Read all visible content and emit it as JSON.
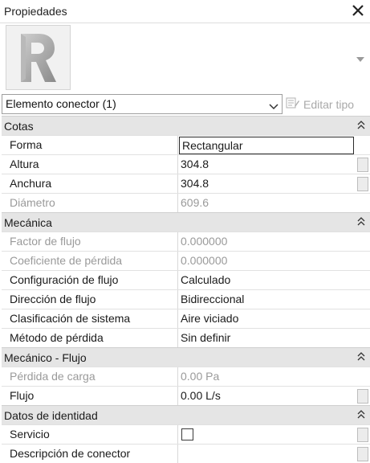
{
  "panel": {
    "title": "Propiedades"
  },
  "type_selector": {
    "value": "Elemento conector (1)",
    "edit_type_label": "Editar tipo"
  },
  "groups": [
    {
      "label": "Cotas",
      "rows": [
        {
          "name": "Forma",
          "value": "Rectangular"
        },
        {
          "name": "Altura",
          "value": "304.8"
        },
        {
          "name": "Anchura",
          "value": "304.8"
        },
        {
          "name": "Diámetro",
          "value": "609.6"
        }
      ]
    },
    {
      "label": "Mecánica",
      "rows": [
        {
          "name": "Factor de flujo",
          "value": "0.000000"
        },
        {
          "name": "Coeficiente de pérdida",
          "value": "0.000000"
        },
        {
          "name": "Configuración de flujo",
          "value": "Calculado"
        },
        {
          "name": "Dirección de flujo",
          "value": "Bidireccional"
        },
        {
          "name": "Clasificación de sistema",
          "value": "Aire viciado"
        },
        {
          "name": "Método de pérdida",
          "value": "Sin definir"
        }
      ]
    },
    {
      "label": "Mecánico - Flujo",
      "rows": [
        {
          "name": "Pérdida de carga",
          "value": "0.00 Pa"
        },
        {
          "name": "Flujo",
          "value": "0.00 L/s"
        }
      ]
    },
    {
      "label": "Datos de identidad",
      "rows": [
        {
          "name": "Servicio",
          "value": ""
        },
        {
          "name": "Descripción de conector",
          "value": ""
        }
      ]
    }
  ],
  "colors": {
    "section_bg": "#e5e5e5",
    "disabled_text": "#9a9a9a",
    "border": "#d8d8d8"
  }
}
